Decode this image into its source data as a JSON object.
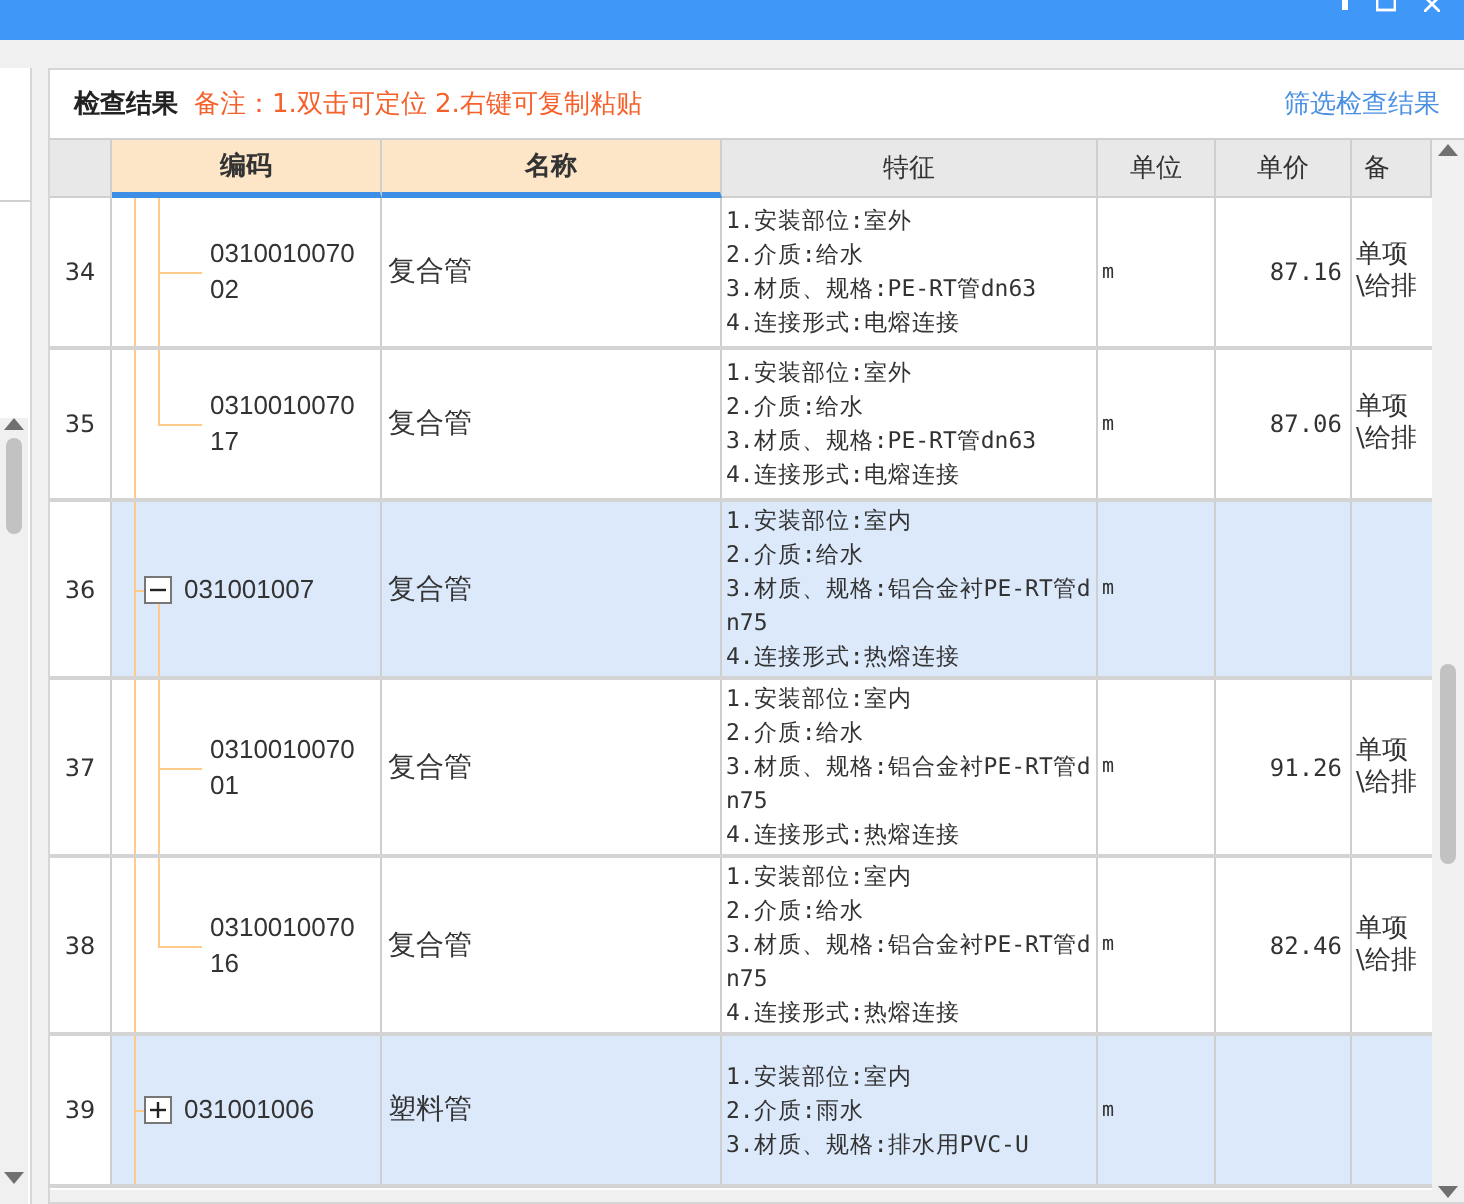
{
  "panel": {
    "title": "检查结果",
    "note": "备注：1.双击可定位 2.右键可复制粘贴",
    "filter_link": "筛选检查结果"
  },
  "table": {
    "columns": [
      {
        "highlighted": false
      },
      {
        "label": "编码",
        "highlighted": true
      },
      {
        "label": "名称",
        "highlighted": true
      },
      {
        "label": "特征",
        "highlighted": false
      },
      {
        "label": "单位",
        "highlighted": false
      },
      {
        "label": "单价",
        "highlighted": false
      },
      {
        "label": "备",
        "highlighted": false
      }
    ],
    "rows": [
      {
        "index": "34",
        "kind": "child",
        "code": "031001007002",
        "name": "复合管",
        "features": [
          "1.安装部位:室外",
          "2.介质:给水",
          "3.材质、规格:PE-RT管dn63",
          "4.连接形式:电熔连接"
        ],
        "unit": "m",
        "price": "87.16",
        "remark": [
          "单项",
          "\\给排"
        ]
      },
      {
        "index": "35",
        "kind": "child",
        "code": "031001007017",
        "name": "复合管",
        "features": [
          "1.安装部位:室外",
          "2.介质:给水",
          "3.材质、规格:PE-RT管dn63",
          "4.连接形式:电熔连接"
        ],
        "unit": "m",
        "price": "87.06",
        "remark": [
          "单项",
          "\\给排"
        ]
      },
      {
        "index": "36",
        "kind": "group",
        "expanded": true,
        "code": "031001007",
        "name": "复合管",
        "features": [
          "1.安装部位:室内",
          "2.介质:给水",
          "3.材质、规格:铝合金衬PE-RT管dn75",
          "4.连接形式:热熔连接"
        ],
        "unit": "m"
      },
      {
        "index": "37",
        "kind": "child",
        "code": "031001007001",
        "name": "复合管",
        "features": [
          "1.安装部位:室内",
          "2.介质:给水",
          "3.材质、规格:铝合金衬PE-RT管dn75",
          "4.连接形式:热熔连接"
        ],
        "unit": "m",
        "price": "91.26",
        "remark": [
          "单项",
          "\\给排"
        ]
      },
      {
        "index": "38",
        "kind": "child",
        "code": "031001007016",
        "name": "复合管",
        "features": [
          "1.安装部位:室内",
          "2.介质:给水",
          "3.材质、规格:铝合金衬PE-RT管dn75",
          "4.连接形式:热熔连接"
        ],
        "unit": "m",
        "price": "82.46",
        "remark": [
          "单项",
          "\\给排"
        ]
      },
      {
        "index": "39",
        "kind": "group",
        "expanded": false,
        "code": "031001006",
        "name": "塑料管",
        "features": [
          "1.安装部位:室内",
          "2.介质:雨水",
          "3.材质、规格:排水用PVC-U"
        ],
        "unit": "m"
      }
    ]
  }
}
